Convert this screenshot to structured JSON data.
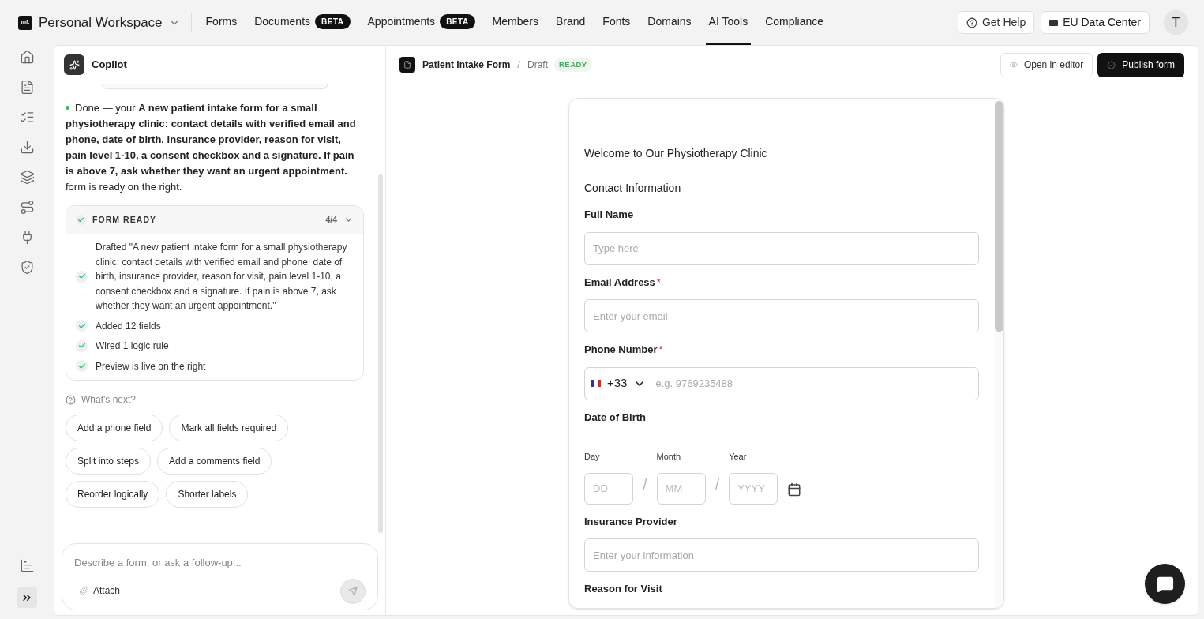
{
  "workspace": {
    "logo": "mf.",
    "name": "Personal Workspace"
  },
  "nav": [
    {
      "label": "Forms",
      "selected": false
    },
    {
      "label": "Documents",
      "badge": "BETA",
      "selected": false
    },
    {
      "label": "Appointments",
      "badge": "BETA",
      "selected": false
    },
    {
      "label": "Members",
      "selected": false
    },
    {
      "label": "Brand",
      "selected": false
    },
    {
      "label": "Fonts",
      "selected": false
    },
    {
      "label": "Domains",
      "selected": false
    },
    {
      "label": "AI Tools",
      "selected": true
    },
    {
      "label": "Compliance",
      "selected": false
    }
  ],
  "header_actions": {
    "help": "Get Help",
    "region": "EU Data Center",
    "avatar": "T"
  },
  "copilot": {
    "title": "Copilot",
    "message": "Done — your **A new patient intake form for a small physiotherapy clinic: contact details with verified email and phone, date of birth, insurance provider, reason for visit, pain level 1-10, a consent checkbox and a signature. If pain is above 7, ask whether they want an urgent appointment.** form is ready on the right.",
    "status": {
      "title": "FORM READY",
      "count": "4/4",
      "expanded": true,
      "steps": [
        {
          "text": "Drafted \"A new patient intake form for a small physiotherapy clinic: contact details with verified email and phone, date of birth, insurance provider, reason for visit, pain level 1-10, a consent checkbox and a signature. If pain is above 7, ask whether they want an urgent appointment.\"",
          "done": true
        },
        {
          "text": "Added 12 fields",
          "done": true
        },
        {
          "text": "Wired 1 logic rule",
          "done": true
        },
        {
          "text": "Preview is live on the right",
          "done": true
        }
      ]
    },
    "next_title": "What's next?",
    "suggestions": [
      "Add a phone field",
      "Mark all fields required",
      "Split into steps",
      "Add a comments field",
      "Reorder logically",
      "Shorter labels"
    ],
    "input": {
      "placeholder": "Describe a form, or ask a follow-up...",
      "attach": "Attach"
    }
  },
  "preview": {
    "breadcrumb": {
      "title": "Patient Intake Form",
      "separator": "/",
      "status": "Draft",
      "badge": "READY"
    },
    "actions": {
      "open": "Open in editor",
      "publish": "Publish form"
    },
    "form": {
      "required_marker": "*",
      "welcome": "Welcome to Our Physiotherapy Clinic",
      "section": "Contact Information",
      "fields": [
        {
          "kind": "text",
          "label": "Full Name",
          "required": false,
          "placeholder": "Type here"
        },
        {
          "kind": "text",
          "label": "Email Address",
          "required": true,
          "placeholder": "Enter your email"
        },
        {
          "kind": "phone",
          "label": "Phone Number",
          "required": true,
          "code": "+33",
          "placeholder": "e.g. 9769235488"
        },
        {
          "kind": "date",
          "label": "Date of Birth",
          "required": false,
          "parts": [
            {
              "label": "Day",
              "placeholder": "DD"
            },
            {
              "label": "Month",
              "placeholder": "MM"
            },
            {
              "label": "Year",
              "placeholder": "YYYY"
            }
          ],
          "separator": "/"
        },
        {
          "kind": "text",
          "label": "Insurance Provider",
          "required": false,
          "placeholder": "Enter your information"
        },
        {
          "kind": "label",
          "label": "Reason for Visit",
          "required": false
        }
      ]
    }
  }
}
